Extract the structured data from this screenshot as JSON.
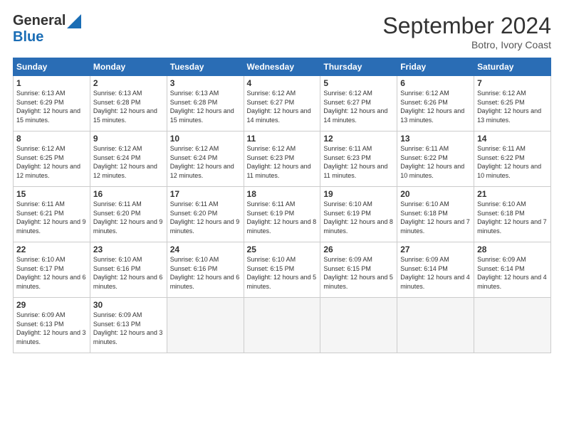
{
  "header": {
    "logo_general": "General",
    "logo_blue": "Blue",
    "month_title": "September 2024",
    "subtitle": "Botro, Ivory Coast"
  },
  "days_of_week": [
    "Sunday",
    "Monday",
    "Tuesday",
    "Wednesday",
    "Thursday",
    "Friday",
    "Saturday"
  ],
  "weeks": [
    [
      {
        "day": "1",
        "sunrise": "6:13 AM",
        "sunset": "6:29 PM",
        "daylight": "12 hours and 15 minutes."
      },
      {
        "day": "2",
        "sunrise": "6:13 AM",
        "sunset": "6:28 PM",
        "daylight": "12 hours and 15 minutes."
      },
      {
        "day": "3",
        "sunrise": "6:13 AM",
        "sunset": "6:28 PM",
        "daylight": "12 hours and 15 minutes."
      },
      {
        "day": "4",
        "sunrise": "6:12 AM",
        "sunset": "6:27 PM",
        "daylight": "12 hours and 14 minutes."
      },
      {
        "day": "5",
        "sunrise": "6:12 AM",
        "sunset": "6:27 PM",
        "daylight": "12 hours and 14 minutes."
      },
      {
        "day": "6",
        "sunrise": "6:12 AM",
        "sunset": "6:26 PM",
        "daylight": "12 hours and 13 minutes."
      },
      {
        "day": "7",
        "sunrise": "6:12 AM",
        "sunset": "6:25 PM",
        "daylight": "12 hours and 13 minutes."
      }
    ],
    [
      {
        "day": "8",
        "sunrise": "6:12 AM",
        "sunset": "6:25 PM",
        "daylight": "12 hours and 12 minutes."
      },
      {
        "day": "9",
        "sunrise": "6:12 AM",
        "sunset": "6:24 PM",
        "daylight": "12 hours and 12 minutes."
      },
      {
        "day": "10",
        "sunrise": "6:12 AM",
        "sunset": "6:24 PM",
        "daylight": "12 hours and 12 minutes."
      },
      {
        "day": "11",
        "sunrise": "6:12 AM",
        "sunset": "6:23 PM",
        "daylight": "12 hours and 11 minutes."
      },
      {
        "day": "12",
        "sunrise": "6:11 AM",
        "sunset": "6:23 PM",
        "daylight": "12 hours and 11 minutes."
      },
      {
        "day": "13",
        "sunrise": "6:11 AM",
        "sunset": "6:22 PM",
        "daylight": "12 hours and 10 minutes."
      },
      {
        "day": "14",
        "sunrise": "6:11 AM",
        "sunset": "6:22 PM",
        "daylight": "12 hours and 10 minutes."
      }
    ],
    [
      {
        "day": "15",
        "sunrise": "6:11 AM",
        "sunset": "6:21 PM",
        "daylight": "12 hours and 9 minutes."
      },
      {
        "day": "16",
        "sunrise": "6:11 AM",
        "sunset": "6:20 PM",
        "daylight": "12 hours and 9 minutes."
      },
      {
        "day": "17",
        "sunrise": "6:11 AM",
        "sunset": "6:20 PM",
        "daylight": "12 hours and 9 minutes."
      },
      {
        "day": "18",
        "sunrise": "6:11 AM",
        "sunset": "6:19 PM",
        "daylight": "12 hours and 8 minutes."
      },
      {
        "day": "19",
        "sunrise": "6:10 AM",
        "sunset": "6:19 PM",
        "daylight": "12 hours and 8 minutes."
      },
      {
        "day": "20",
        "sunrise": "6:10 AM",
        "sunset": "6:18 PM",
        "daylight": "12 hours and 7 minutes."
      },
      {
        "day": "21",
        "sunrise": "6:10 AM",
        "sunset": "6:18 PM",
        "daylight": "12 hours and 7 minutes."
      }
    ],
    [
      {
        "day": "22",
        "sunrise": "6:10 AM",
        "sunset": "6:17 PM",
        "daylight": "12 hours and 6 minutes."
      },
      {
        "day": "23",
        "sunrise": "6:10 AM",
        "sunset": "6:16 PM",
        "daylight": "12 hours and 6 minutes."
      },
      {
        "day": "24",
        "sunrise": "6:10 AM",
        "sunset": "6:16 PM",
        "daylight": "12 hours and 6 minutes."
      },
      {
        "day": "25",
        "sunrise": "6:10 AM",
        "sunset": "6:15 PM",
        "daylight": "12 hours and 5 minutes."
      },
      {
        "day": "26",
        "sunrise": "6:09 AM",
        "sunset": "6:15 PM",
        "daylight": "12 hours and 5 minutes."
      },
      {
        "day": "27",
        "sunrise": "6:09 AM",
        "sunset": "6:14 PM",
        "daylight": "12 hours and 4 minutes."
      },
      {
        "day": "28",
        "sunrise": "6:09 AM",
        "sunset": "6:14 PM",
        "daylight": "12 hours and 4 minutes."
      }
    ],
    [
      {
        "day": "29",
        "sunrise": "6:09 AM",
        "sunset": "6:13 PM",
        "daylight": "12 hours and 3 minutes."
      },
      {
        "day": "30",
        "sunrise": "6:09 AM",
        "sunset": "6:13 PM",
        "daylight": "12 hours and 3 minutes."
      },
      null,
      null,
      null,
      null,
      null
    ]
  ]
}
